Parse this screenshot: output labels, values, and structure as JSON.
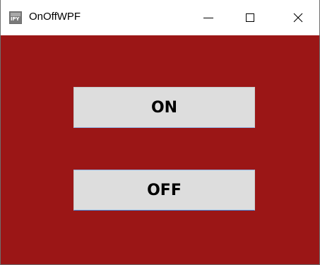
{
  "window": {
    "title": "OnOffWPF",
    "icon": "ipy-app-icon",
    "icon_text": "IPY"
  },
  "titlebar_buttons": {
    "minimize_icon": "minimize-icon",
    "maximize_icon": "maximize-icon",
    "close_icon": "close-icon"
  },
  "main": {
    "background_color": "#9b1616",
    "on_label": "ON",
    "off_label": "OFF"
  }
}
